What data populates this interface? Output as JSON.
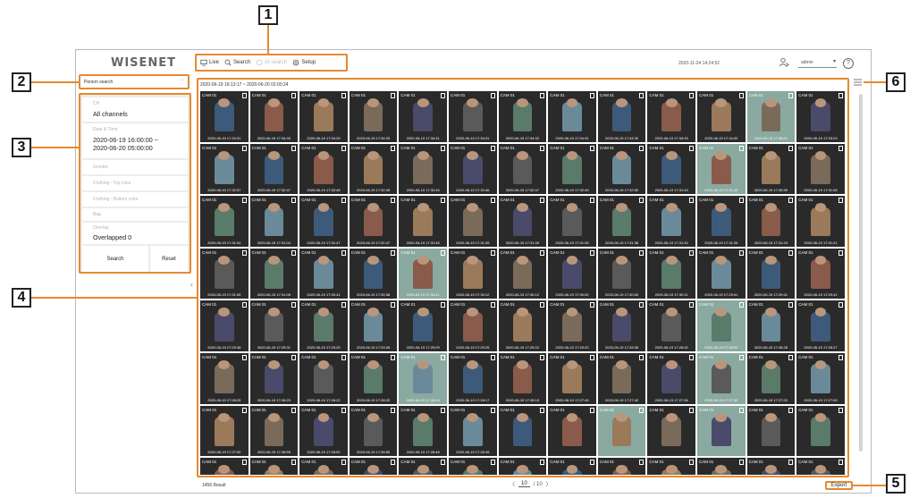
{
  "app": {
    "logo": "WISENET"
  },
  "topnav": {
    "items": [
      {
        "label": "Live",
        "icon": "monitor-icon",
        "enabled": true
      },
      {
        "label": "Search",
        "icon": "search-icon",
        "enabled": true
      },
      {
        "label": "AI search",
        "icon": "ai-search-icon",
        "enabled": false
      },
      {
        "label": "Setup",
        "icon": "gear-icon",
        "enabled": true
      }
    ]
  },
  "header": {
    "datetime": "2020-11-24 14:24:52",
    "user": "admin",
    "help": "?"
  },
  "search_type": {
    "value": "Person search",
    "more": "···"
  },
  "filters": {
    "channel_label": "CH",
    "channel_value": "All channels",
    "datetime_label": "Date & Time",
    "datetime_start": "2020-06-19 16:00:00 ~",
    "datetime_end": "2020-06-20 05:00:00",
    "gender_label": "Gender",
    "top_label": "Clothing : Top color",
    "bottom_label": "Clothing : Bottom color",
    "bag_label": "Bag",
    "overlap_label": "Overlap",
    "overlap_value": "Overlapped 0",
    "search_button": "Search",
    "reset_button": "Reset"
  },
  "results": {
    "range": "2020-06-19 16:13:17 ~ 2020-06-20 02:00:24",
    "count_text": "1456 Result",
    "cam_label": "CAM 01",
    "page_prev": "〈",
    "page_current": "10",
    "page_total": "/ 10",
    "page_next": "〉",
    "export_button": "Export",
    "thumb_dates": [
      "2020-06-19 17:34:31",
      "2020-06-19 17:34:33",
      "2020-06-19 17:34:29",
      "2020-06-19 17:34:29",
      "2020-06-19 17:34:31",
      "2020-06-19 17:34:31",
      "2020-06-19 17:34:32",
      "2020-06-19 17:34:31",
      "2020-06-19 17:34:32",
      "2020-06-19 17:34:33",
      "2020-06-19 17:34:32",
      "2020-06-19 17:35:01",
      "2020-06-19 17:33:23",
      "2020-06-19 17:32:57",
      "2020-06-19 17:32:47",
      "2020-06-19 17:32:46",
      "2020-06-19 17:32:45",
      "2020-06-19 17:32:45",
      "2020-06-19 17:32:46",
      "2020-06-19 17:32:47",
      "2020-06-19 17:32:49",
      "2020-06-19 17:32:52",
      "2020-06-19 17:31:43",
      "2020-06-19 17:31:43",
      "2020-06-19 17:30:59",
      "2020-06-19 17:31:08",
      "2020-06-19 17:31:04",
      "2020-06-19 17:31:04",
      "2020-06-19 17:31:47",
      "2020-06-19 17:31:47",
      "2020-06-19 17:31:45",
      "2020-06-19 17:31:39",
      "2020-06-19 17:31:39",
      "2020-06-19 17:31:39",
      "2020-06-19 17:31:38",
      "2020-06-19 17:31:32",
      "2020-06-19 17:31:26",
      "2020-06-19 17:31:23",
      "2020-06-19 17:31:21",
      "2020-06-19 17:31:05",
      "2020-06-19 17:31:05",
      "2020-06-19 17:30:41",
      "2020-06-19 17:30:38",
      "2020-06-19 17:30:41",
      "2020-06-19 17:30:12",
      "2020-06-19 17:30:12",
      "2020-06-19 17:30:02",
      "2020-06-19 17:30:00",
      "2020-06-19 17:30:11",
      "2020-06-19 17:29:41",
      "2020-06-19 17:29:41",
      "2020-06-19 17:29:41",
      "2020-06-19 17:29:38",
      "2020-06-19 17:29:31",
      "2020-06-19 17:29:29",
      "2020-06-19 17:29:26",
      "2020-06-19 17:29:29",
      "2020-06-19 17:29:25",
      "2020-06-19 17:29:22",
      "2020-06-19 17:29:20",
      "2020-06-19 17:28:35",
      "2020-06-19 17:28:32",
      "2020-06-19 17:28:30",
      "2020-06-19 17:28:28",
      "2020-06-19 17:28:27",
      "2020-06-19 17:28:25",
      "2020-06-19 17:28:23",
      "2020-06-19 17:28:22",
      "2020-06-19 17:28:20",
      "2020-06-19 17:28:19",
      "2020-06-19 17:28:17",
      "2020-06-19 17:28:15",
      "2020-06-19 17:27:49",
      "2020-06-19 17:27:40",
      "2020-06-19 17:27:36",
      "2020-06-19 17:27:30",
      "2020-06-19 17:27:20",
      "2020-06-19 17:27:09",
      "2020-06-19 17:27:00",
      "2020-06-19 17:26:55",
      "2020-06-19 17:26:52",
      "2020-06-19 17:26:50",
      "2020-06-19 17:26:48",
      "2020-06-19 17:26:45",
      "",
      "",
      "",
      "",
      "",
      "",
      "",
      "",
      "",
      "",
      "",
      ""
    ]
  },
  "callouts": [
    "1",
    "2",
    "3",
    "4",
    "5",
    "6"
  ],
  "colors": {
    "accent": "#e6892f",
    "border": "#b9b9b9"
  }
}
